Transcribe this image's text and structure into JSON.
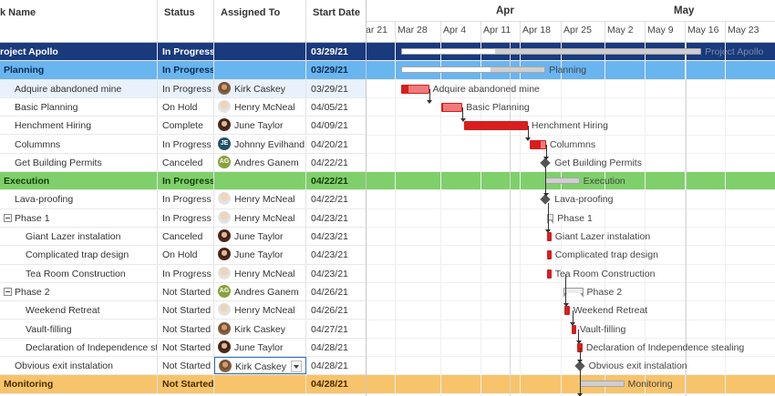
{
  "columns": {
    "name": "k Name",
    "status": "Status",
    "assigned": "Assigned To",
    "start": "Start Date"
  },
  "timeline": {
    "months": [
      "Apr",
      "May"
    ],
    "weeks": [
      "ar 21",
      "Mar 28",
      "Apr 4",
      "Apr 11",
      "Apr 18",
      "Apr 25",
      "May 2",
      "May 9",
      "May 16",
      "May 23"
    ]
  },
  "rows": [
    {
      "name": "roject Apollo",
      "status": "In Progress",
      "assignee": "",
      "start": "03/29/21",
      "type": "project",
      "label": "Project Apollo",
      "progress": 0.31
    },
    {
      "name": "Planning",
      "status": "In Progress",
      "assignee": "",
      "start": "03/29/21",
      "type": "planning",
      "label": "Planning",
      "progress": 0.62
    },
    {
      "name": "Adquire abandoned mine",
      "status": "In Progress",
      "assignee": "Kirk Caskey",
      "avatar": "kirk",
      "start": "03/29/21",
      "type": "task",
      "label": "Adquire abandoned mine",
      "progress": 0.25,
      "hover": true
    },
    {
      "name": "Basic Planning",
      "status": "On Hold",
      "assignee": "Henry McNeal",
      "avatar": "henry",
      "start": "04/05/21",
      "type": "task",
      "label": "Basic Planning",
      "progress": 0.05
    },
    {
      "name": "Henchment Hiring",
      "status": "Complete",
      "assignee": "June Taylor",
      "avatar": "june",
      "start": "04/09/21",
      "type": "task",
      "label": "Henchment Hiring",
      "progress": 1.0
    },
    {
      "name": "Colummns",
      "status": "In Progress",
      "assignee": "Johnny Evilhand",
      "avatar": "je",
      "initials": "JE",
      "start": "04/20/21",
      "type": "task",
      "label": "Colummns",
      "progress": 0.7
    },
    {
      "name": "Get Building Permits",
      "status": "Canceled",
      "assignee": "Andres Ganem",
      "avatar": "ag",
      "initials": "AG",
      "start": "04/22/21",
      "type": "milestone",
      "label": "Get Building Permits"
    },
    {
      "name": "Execution",
      "status": "In Progress",
      "assignee": "",
      "start": "04/22/21",
      "type": "execution",
      "label": "Execution",
      "progress": 0.0
    },
    {
      "name": "Lava-proofing",
      "status": "In Progress",
      "assignee": "Henry McNeal",
      "avatar": "henry",
      "start": "04/22/21",
      "type": "milestone",
      "label": "Lava-proofing"
    },
    {
      "name": "Phase 1",
      "status": "In Progress",
      "assignee": "Henry McNeal",
      "avatar": "henry",
      "start": "04/23/21",
      "type": "group",
      "label": "Phase 1"
    },
    {
      "name": "Giant Lazer instalation",
      "status": "Canceled",
      "assignee": "June Taylor",
      "avatar": "june",
      "start": "04/23/21",
      "type": "task",
      "label": "Giant Lazer instalation",
      "progress": 1.0,
      "indent": 2
    },
    {
      "name": "Complicated trap design",
      "status": "On Hold",
      "assignee": "June Taylor",
      "avatar": "june",
      "start": "04/23/21",
      "type": "task",
      "label": "Complicated trap design",
      "progress": 1.0,
      "indent": 2
    },
    {
      "name": "Tea Room Construction",
      "status": "In Progress",
      "assignee": "Henry McNeal",
      "avatar": "henry",
      "start": "04/23/21",
      "type": "task",
      "label": "Tea Room Construction",
      "progress": 1.0,
      "indent": 2
    },
    {
      "name": "Phase 2",
      "status": "Not Started",
      "assignee": "Andres Ganem",
      "avatar": "ag",
      "initials": "AG",
      "start": "04/26/21",
      "type": "group",
      "label": "Phase 2"
    },
    {
      "name": "Weekend Retreat",
      "status": "Not Started",
      "assignee": "Henry McNeal",
      "avatar": "henry",
      "start": "04/26/21",
      "type": "task",
      "label": "Weekend Retreat",
      "progress": 1.0,
      "indent": 2
    },
    {
      "name": "Vault-filling",
      "status": "Not Started",
      "assignee": "Kirk Caskey",
      "avatar": "kirk",
      "start": "04/27/21",
      "type": "task",
      "label": "Vault-filling",
      "progress": 1.0,
      "indent": 2
    },
    {
      "name": "Declaration of Independence stealing",
      "status": "Not Started",
      "assignee": "June Taylor",
      "avatar": "june",
      "start": "04/28/21",
      "type": "task",
      "label": "Declaration of Independence stealing",
      "progress": 1.0,
      "indent": 2
    },
    {
      "name": "Obvious exit instalation",
      "status": "Not Started",
      "assignee": "Kirk Caskey",
      "avatar": "kirk",
      "start": "04/28/21",
      "type": "milestone",
      "label": "Obvious exit instalation",
      "editing": true
    },
    {
      "name": "Monitoring",
      "status": "Not Started",
      "assignee": "",
      "start": "04/28/21",
      "type": "monitoring",
      "label": "Monitoring",
      "progress": 0.0
    }
  ],
  "colors": {
    "project": "#1a3a7e",
    "planning": "#69b5f0",
    "execution": "#7fd06b",
    "monitoring": "#f7c46b",
    "task_bar": "#d81e1e"
  }
}
